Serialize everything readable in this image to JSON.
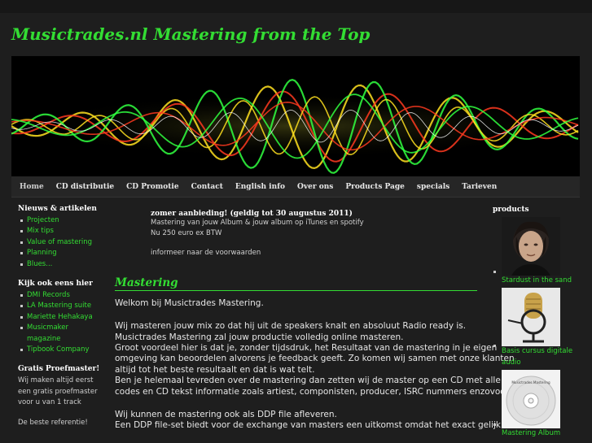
{
  "site": {
    "title": "Musictrades.nl Mastering from the Top"
  },
  "nav": {
    "items": [
      {
        "label": "Home"
      },
      {
        "label": "CD distributie"
      },
      {
        "label": "CD Promotie"
      },
      {
        "label": "Contact"
      },
      {
        "label": "English info"
      },
      {
        "label": "Over ons"
      },
      {
        "label": "Products Page"
      },
      {
        "label": "specials"
      },
      {
        "label": "Tarieven"
      }
    ]
  },
  "sidebar": {
    "news_heading": "Nieuws & artikelen",
    "news_items": [
      {
        "label": "Projecten"
      },
      {
        "label": "Mix tips"
      },
      {
        "label": "Value of mastering"
      },
      {
        "label": "Planning"
      },
      {
        "label": "Blues..."
      }
    ],
    "look_heading": "Kijk ook eens hier",
    "look_items": [
      {
        "label": "DMI Records"
      },
      {
        "label": "LA Mastering suite"
      },
      {
        "label": "Mariette Hehakaya"
      },
      {
        "label": "Musicmaker magazine"
      },
      {
        "label": "Tipbook Company"
      }
    ],
    "proef_heading": "Gratis Proefmaster!",
    "proef_text": "Wij maken altijd eerst een gratis proefmaster voor u van 1 track",
    "ref_text": "De beste referentie!"
  },
  "main": {
    "promo_title": "zomer aanbieding!  (geldig tot 30 augustus 2011)",
    "promo_line1": "Mastering van jouw Album & jouw album op iTunes en spotify",
    "promo_line2": "Nu 250 euro ex BTW",
    "promo_link": "informeer naar de voorwaarden",
    "heading": "Mastering",
    "welcome": "Welkom bij Musictrades Mastering.",
    "para1": [
      "Wij masteren jouw mix zo dat hij uit de speakers knalt en absoluut Radio ready is.",
      "Musictrades Mastering zal jouw productie volledig online masteren.",
      "Groot voordeel hier is dat je, zonder tijdsdruk, het Resultaat van de  mastering  in je eigen",
      "omgeving kan beoordelen alvorens je feedback geeft. Zo komen wij samen met onze klanten",
      "altijd tot het beste resultaalt en dat is wat telt.",
      "Ben je helemaal tevreden over de mastering  dan zetten wij de master op een CD met alle",
      "codes en CD tekst informatie zoals artiest, componisten, producer, ISRC nummers enzovoort."
    ],
    "para2": [
      "Wij kunnen de mastering  ook als DDP file afleveren.",
      "Een DDP file-set biedt voor de exchange van masters een uitkomst omdat het exact gelijk is"
    ]
  },
  "products": {
    "heading": "products",
    "items": [
      {
        "label": "Stardust in the sand",
        "icon": "portrait-photo-icon"
      },
      {
        "label": "Basis cursus digitale audio",
        "icon": "microphone-photo-icon"
      },
      {
        "label": "Mastering Album",
        "icon": "cd-disc-icon",
        "disc_text": "Musictrades Mastering"
      }
    ]
  },
  "colors": {
    "accent_green": "#33dd33",
    "background": "#1e1e1e",
    "nav_background": "#262626"
  }
}
